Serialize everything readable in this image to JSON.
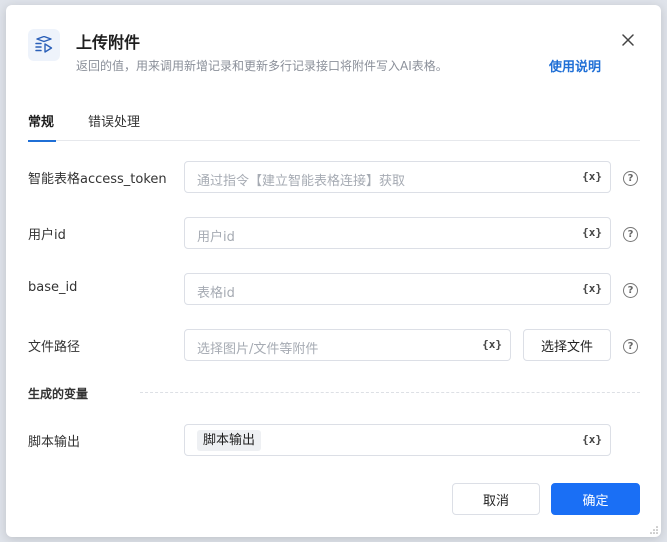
{
  "header": {
    "title": "上传附件",
    "subtitle": "返回的值，用来调用新增记录和更新多行记录接口将附件写入AI表格。",
    "help_link": "使用说明"
  },
  "tabs": [
    {
      "label": "常规",
      "active": true
    },
    {
      "label": "错误处理",
      "active": false
    }
  ],
  "fields": {
    "access_token": {
      "label": "智能表格access_token",
      "placeholder": "通过指令【建立智能表格连接】获取",
      "var_icon": "{x}"
    },
    "user_id": {
      "label": "用户id",
      "placeholder": "用户id",
      "var_icon": "{x}"
    },
    "base_id": {
      "label": "base_id",
      "placeholder": "表格id",
      "var_icon": "{x}"
    },
    "file_path": {
      "label": "文件路径",
      "placeholder": "选择图片/文件等附件",
      "var_icon": "{x}",
      "choose_button": "选择文件"
    }
  },
  "output_section": {
    "title": "生成的变量",
    "label": "脚本输出",
    "tag": "脚本输出",
    "var_icon": "{x}"
  },
  "footer": {
    "cancel": "取消",
    "confirm": "确定"
  },
  "help_icon": "?",
  "colors": {
    "accent": "#1a6ff5",
    "link": "#1f6fd6"
  }
}
